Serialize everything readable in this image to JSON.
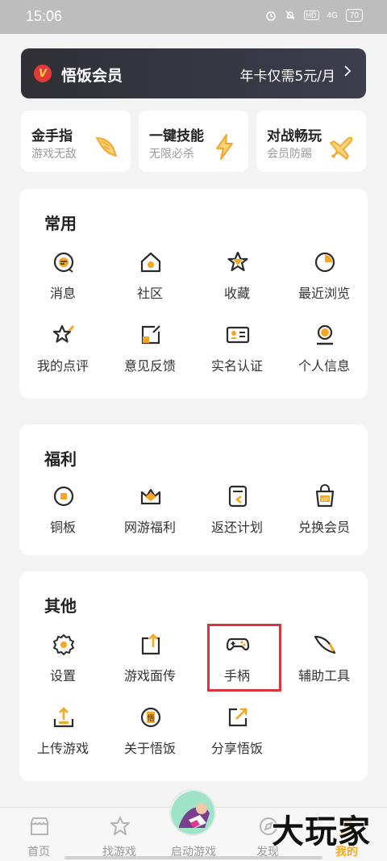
{
  "status_bar": {
    "time": "15:06",
    "network": "4G",
    "hd": "HD",
    "battery": "70"
  },
  "vip": {
    "badge": "V",
    "title": "悟饭会员",
    "promo": "年卡仅需5元/月"
  },
  "features": [
    {
      "title": "金手指",
      "subtitle": "游戏无敌",
      "icon": "wing-icon"
    },
    {
      "title": "一键技能",
      "subtitle": "无限必杀",
      "icon": "lightning-icon"
    },
    {
      "title": "对战畅玩",
      "subtitle": "会员防踢",
      "icon": "plane-icon"
    }
  ],
  "sections": {
    "common": {
      "title": "常用",
      "items": [
        {
          "label": "消息",
          "icon": "message-icon"
        },
        {
          "label": "社区",
          "icon": "home-icon"
        },
        {
          "label": "收藏",
          "icon": "star-icon"
        },
        {
          "label": "最近浏览",
          "icon": "clock-icon"
        },
        {
          "label": "我的点评",
          "icon": "review-star-icon"
        },
        {
          "label": "意见反馈",
          "icon": "feedback-icon"
        },
        {
          "label": "实名认证",
          "icon": "id-card-icon"
        },
        {
          "label": "个人信息",
          "icon": "user-icon"
        }
      ]
    },
    "welfare": {
      "title": "福利",
      "items": [
        {
          "label": "铜板",
          "icon": "coin-icon"
        },
        {
          "label": "网游福利",
          "icon": "crown-icon"
        },
        {
          "label": "返还计划",
          "icon": "refund-icon"
        },
        {
          "label": "兑换会员",
          "icon": "vip-bag-icon"
        }
      ]
    },
    "other": {
      "title": "其他",
      "items": [
        {
          "label": "设置",
          "icon": "gear-icon"
        },
        {
          "label": "游戏面传",
          "icon": "upload-box-icon"
        },
        {
          "label": "手柄",
          "icon": "gamepad-icon"
        },
        {
          "label": "辅助工具",
          "icon": "wing-tool-icon"
        },
        {
          "label": "上传游戏",
          "icon": "upload-icon"
        },
        {
          "label": "关于悟饭",
          "icon": "about-icon"
        },
        {
          "label": "分享悟饭",
          "icon": "share-icon"
        }
      ]
    }
  },
  "tabbar": {
    "items": [
      {
        "label": "首页",
        "icon": "shop-icon"
      },
      {
        "label": "找游戏",
        "icon": "star-outline-icon"
      },
      {
        "label": "启动游戏",
        "icon": "launch-icon"
      },
      {
        "label": "发现",
        "icon": "discover-icon"
      },
      {
        "label": "我的",
        "icon": "profile-icon"
      }
    ],
    "active_index": 4
  },
  "watermark": "大玩家",
  "colors": {
    "accent": "#f5a623",
    "dark": "#2b2b2b",
    "highlight": "#d9333b"
  }
}
